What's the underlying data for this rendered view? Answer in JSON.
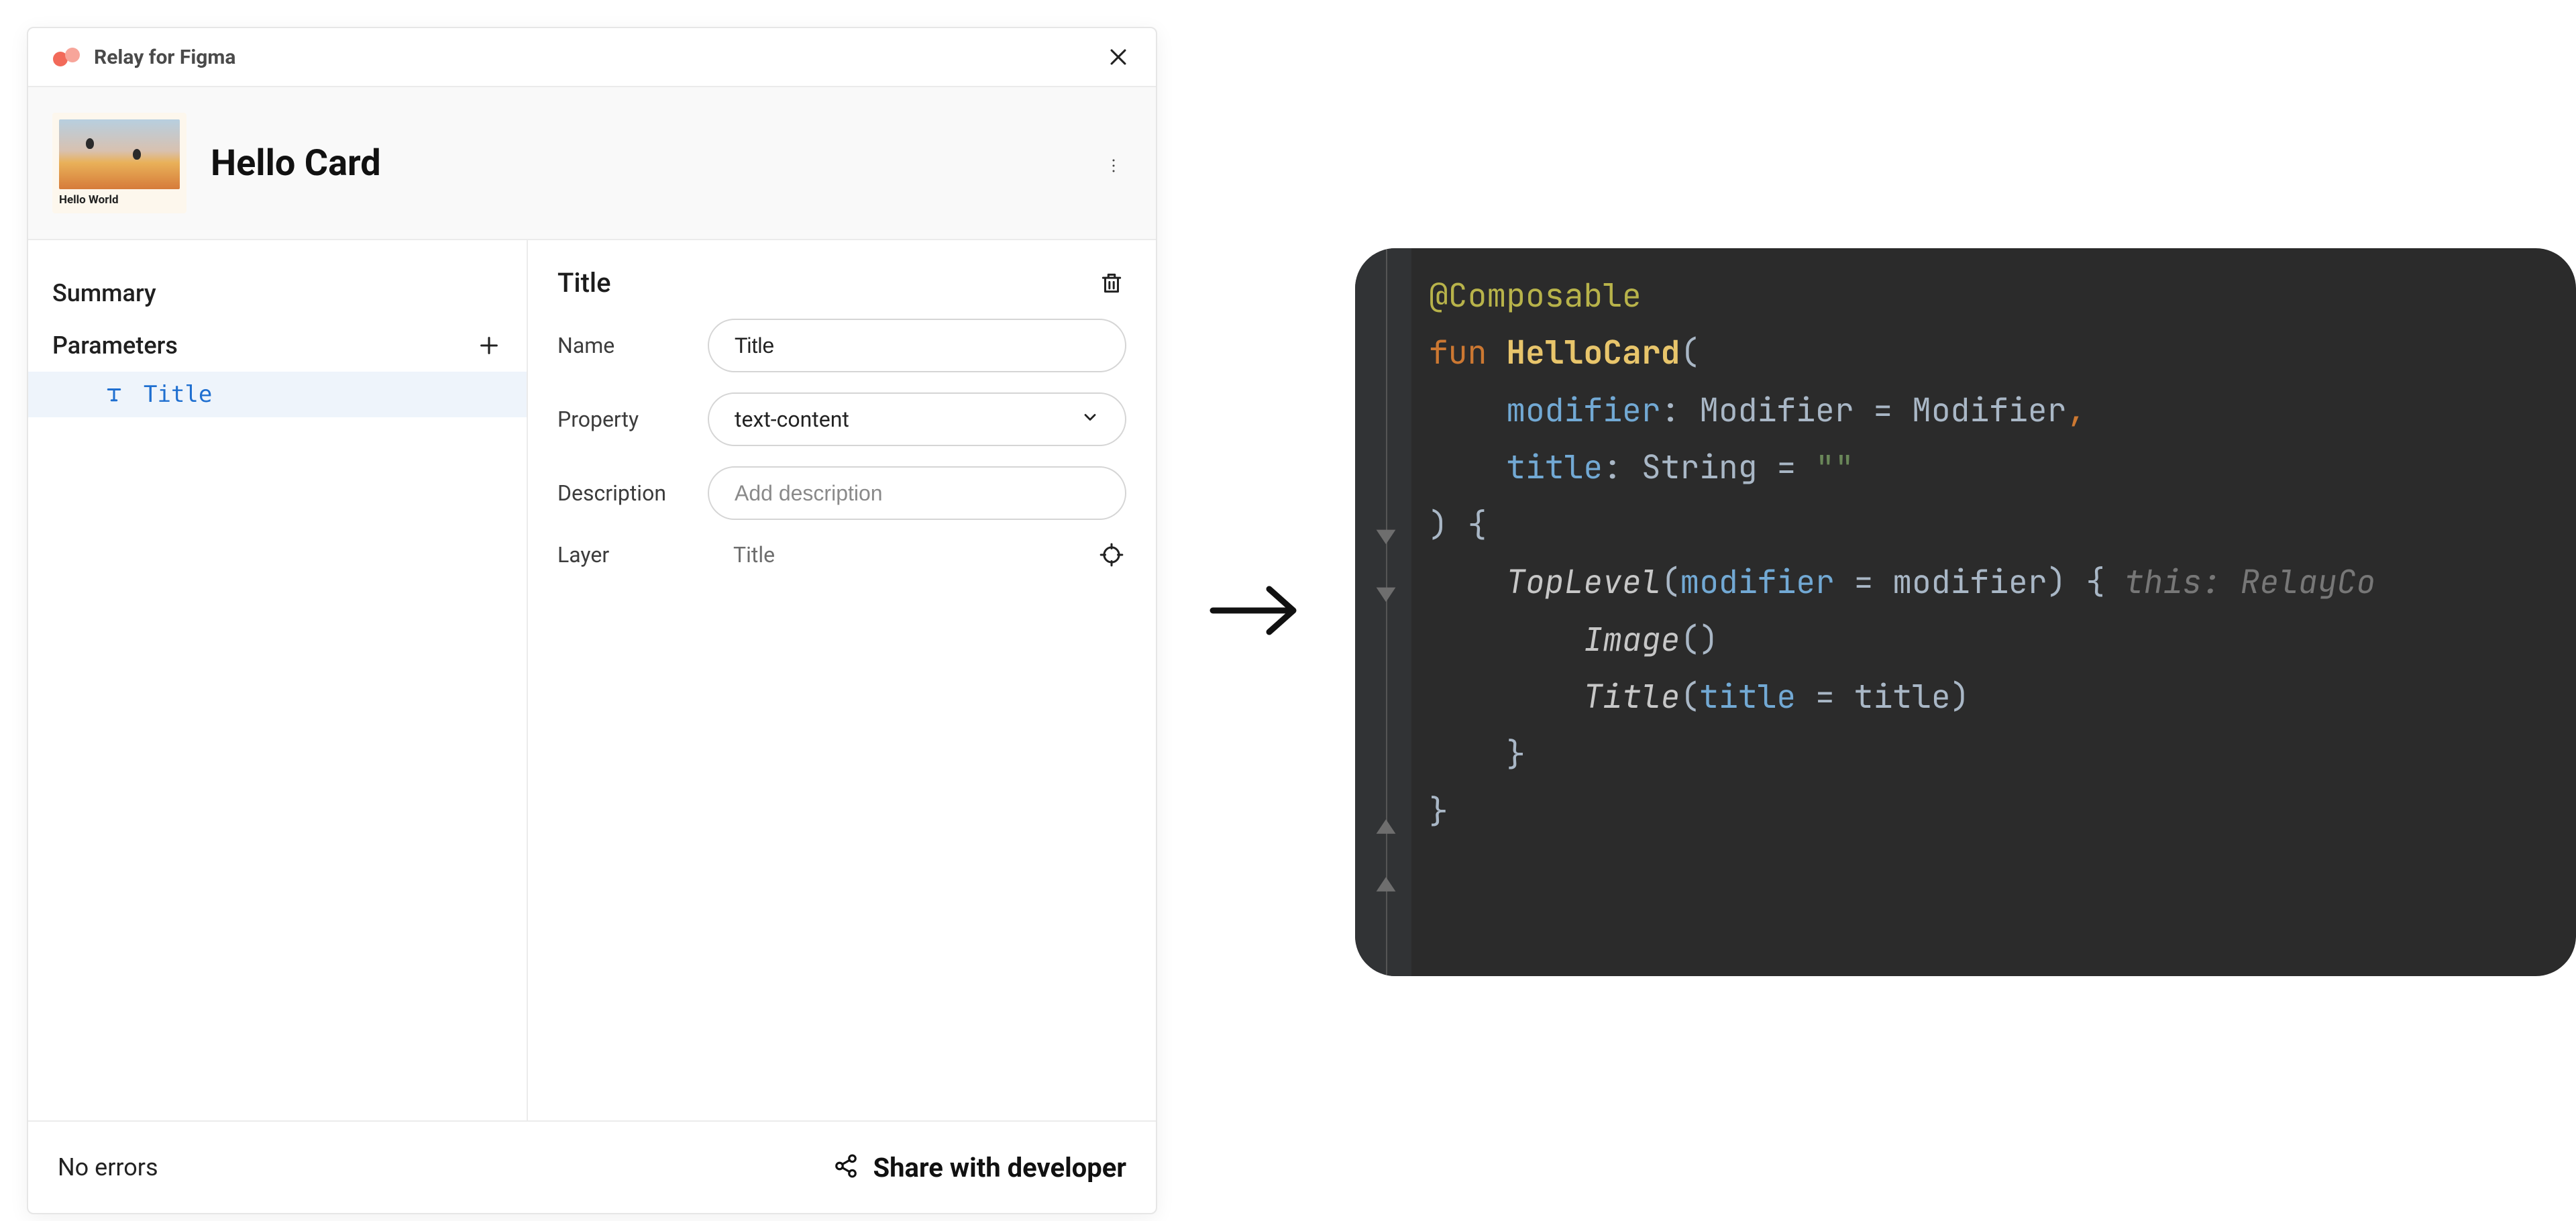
{
  "plugin": {
    "title": "Relay for Figma",
    "card_name": "Hello Card",
    "thumb_caption": "Hello World"
  },
  "sidebar": {
    "summary_label": "Summary",
    "parameters_label": "Parameters",
    "param_item": {
      "name": "Title"
    }
  },
  "detail": {
    "heading": "Title",
    "name_label": "Name",
    "name_value": "Title",
    "property_label": "Property",
    "property_value": "text-content",
    "description_label": "Description",
    "description_placeholder": "Add description",
    "layer_label": "Layer",
    "layer_value": "Title"
  },
  "footer": {
    "errors": "No errors",
    "share": "Share with developer"
  },
  "code": {
    "tokens": {
      "l1_ann": "@Composable",
      "l2_kw": "fun",
      "l2_fn": "HelloCard",
      "l2_paren": "(",
      "l3_p1": "modifier",
      "l3_t1": "Modifier",
      "l3_d1": "Modifier",
      "l4_p1": "title",
      "l4_t1": "String",
      "l4_str": "\"\"",
      "l5": ") {",
      "l6_call": "TopLevel",
      "l6_arg": "modifier",
      "l6_hint": "this: RelayCo",
      "l7_call": "Image",
      "l8_call": "Title",
      "l8_arg": "title",
      "l9": "}",
      "l10": "}"
    }
  }
}
